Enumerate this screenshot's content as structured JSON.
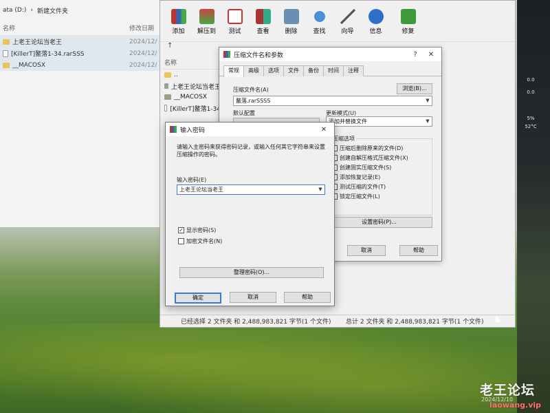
{
  "explorer": {
    "path_drive": "ata (D:)",
    "path_folder": "新建文件夹",
    "col_name": "名称",
    "col_date": "修改日期",
    "rows": [
      {
        "name": "上老王论坛当老王",
        "date": "2024/12/"
      },
      {
        "name": "[KillerT]鳌落1-34.rarSSS",
        "date": "2024/12/"
      },
      {
        "name": "__MACOSX",
        "date": "2024/12/"
      }
    ]
  },
  "winrar": {
    "toolbar": [
      "添加",
      "解压到",
      "测试",
      "查看",
      "删除",
      "查找",
      "向导",
      "信息",
      "修复"
    ],
    "col_name": "名称",
    "list": [
      "..",
      "上老王论坛当老王",
      "__MACOSX",
      "[KillerT]鳌落1-34"
    ],
    "status_left": "已经选择 2 文件夹 和 2,488,983,821 字节(1 个文件)",
    "status_right": "总计 2 文件夹 和 2,488,983,821 字节(1 个文件)"
  },
  "params": {
    "title": "压缩文件名和参数",
    "help_btn": "?",
    "close_btn": "✕",
    "tabs": [
      "常规",
      "高级",
      "选项",
      "文件",
      "备份",
      "时间",
      "注释"
    ],
    "archive_label": "压缩文件名(A)",
    "browse_btn": "浏览(B)...",
    "archive_value": "鳌落.rarSSSS",
    "default_profile": "默认配置",
    "update_mode_label": "更新模式(U)",
    "update_mode_value": "添加并替换文件",
    "options_label": "压缩选项",
    "options": [
      "压缩后删除原来的文件(D)",
      "创建自解压格式压缩文件(X)",
      "创建固实压缩文件(S)",
      "添加恢复记录(E)",
      "测试压缩的文件(T)",
      "锁定压缩文件(L)"
    ],
    "set_password_btn": "设置密码(P)...",
    "cancel_btn": "取消",
    "help_btn2": "帮助"
  },
  "password_dialog": {
    "title": "输入密码",
    "close_btn": "✕",
    "description": "请输入主密码来获得密码记录，或输入任何其它字符串来设置压缩操作的密码。",
    "input_label": "输入密码(E)",
    "input_value": "上老王论坛当老王",
    "show_password_label": "显示密码(S)",
    "show_password_checked": true,
    "encrypt_names_label": "加密文件名(N)",
    "encrypt_names_checked": false,
    "organize_btn": "整理密码(O)...",
    "ok_btn": "确定",
    "cancel_btn": "取消",
    "help_btn": "帮助"
  },
  "right_panel": {
    "values": [
      "0.0",
      "0.0",
      "5%",
      "52°C"
    ]
  },
  "watermark": {
    "title": "老王论坛",
    "url": "laowang.vip"
  },
  "taskbar": {
    "date": "2024/12/10"
  }
}
